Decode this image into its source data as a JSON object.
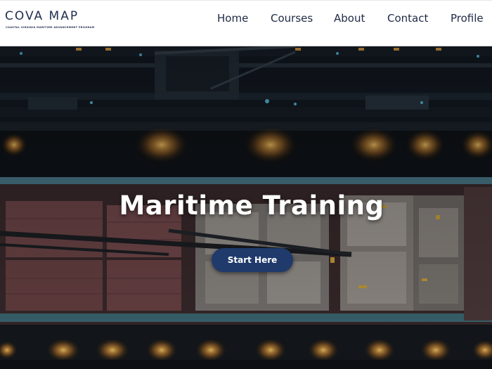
{
  "brand": {
    "title": "COVA MAP",
    "subtitle": "COASTAL VIRGINIA MARITIME ADVANCEMENT PROGRAM"
  },
  "nav": {
    "items": [
      {
        "label": "Home"
      },
      {
        "label": "Courses"
      },
      {
        "label": "About"
      },
      {
        "label": "Contact"
      },
      {
        "label": "Profile"
      }
    ]
  },
  "hero": {
    "title": "Maritime Training",
    "cta_label": "Start Here",
    "image": "aerial-ship-at-dock-night"
  },
  "colors": {
    "brand_navy": "#1f2d4d",
    "button": "#1f3a6b",
    "header_bg": "#ffffff",
    "hero_bg": "#0d1117"
  }
}
